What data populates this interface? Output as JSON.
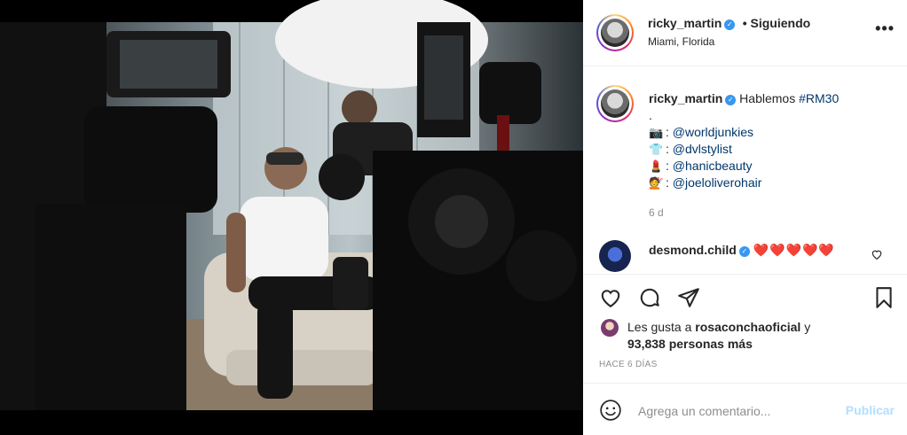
{
  "post": {
    "author": "ricky_martin",
    "follow_state": "• Siguiendo",
    "location": "Miami, Florida",
    "more_icon": "more-horizontal-icon"
  },
  "caption": {
    "author": "ricky_martin",
    "text": "Hablemos",
    "hashtag": "#RM30",
    "dot": ".",
    "credits": [
      {
        "emoji": "📷",
        "handle": "@worldjunkies"
      },
      {
        "emoji": "👕",
        "handle": "@dvlstylist"
      },
      {
        "emoji": "💄",
        "handle": "@hanicbeauty"
      },
      {
        "emoji": "💇",
        "handle": "@joeloliverohair"
      }
    ],
    "time": "6 d"
  },
  "comment": {
    "author": "desmond.child",
    "text": "❤️❤️❤️❤️❤️"
  },
  "likes": {
    "prefix": "Les gusta a",
    "user": "rosaconchaoficial",
    "conj": "y",
    "count": "93,838 personas más"
  },
  "timestamp": "HACE 6 DÍAS",
  "compose": {
    "placeholder": "Agrega un comentario...",
    "publish": "Publicar"
  },
  "colors": {
    "link": "#00376b",
    "verified": "#3897f0",
    "heart": "#ed4956",
    "publish_disabled": "#b2dffc"
  }
}
